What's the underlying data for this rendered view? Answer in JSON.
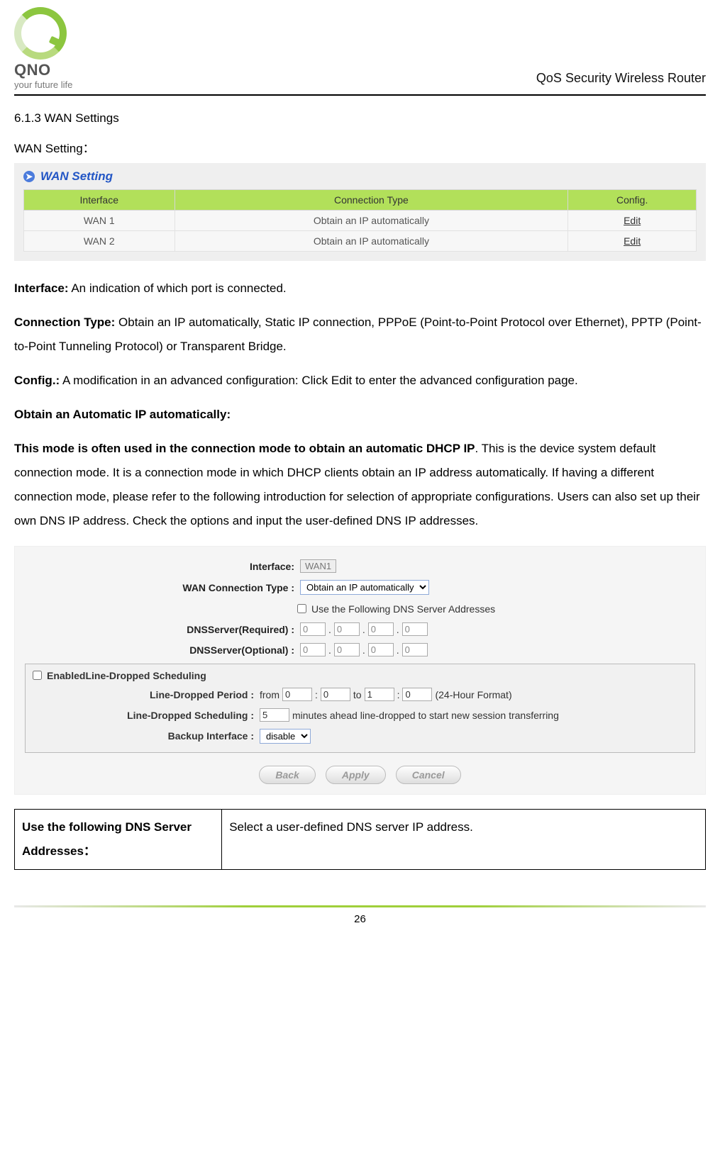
{
  "header": {
    "brand": "QNO",
    "tagline": "your future life",
    "doc_title": "QoS Security Wireless Router"
  },
  "section": {
    "number": "6.1.3 WAN Settings",
    "subtitle": "WAN Setting："
  },
  "wan_panel": {
    "title": "WAN Setting",
    "columns": {
      "c1": "Interface",
      "c2": "Connection Type",
      "c3": "Config."
    },
    "rows": [
      {
        "iface": "WAN 1",
        "type": "Obtain an IP automatically",
        "cfg": "Edit"
      },
      {
        "iface": "WAN 2",
        "type": "Obtain an IP automatically",
        "cfg": "Edit"
      }
    ]
  },
  "body": {
    "interface_label": "Interface:",
    "interface_text": " An indication of which port is connected.",
    "conntype_label": "Connection Type:",
    "conntype_text": " Obtain an IP automatically, Static IP connection, PPPoE (Point-to-Point Protocol over Ethernet), PPTP (Point-to-Point Tunneling Protocol) or Transparent Bridge.",
    "config_label": "Config.:",
    "config_text": " A modification in an advanced configuration: Click Edit to enter the advanced configuration page.",
    "auto_heading": "Obtain an Automatic IP automatically:",
    "auto_bold": "This mode is often used in the connection mode to obtain an automatic DHCP IP",
    "auto_rest": ". This is the device system default connection mode. It is a connection mode in which DHCP clients obtain an IP address automatically. If having a different connection mode, please refer to the following introduction for selection of appropriate configurations. Users can also set up their own DNS IP address. Check the options and input the user-defined DNS IP addresses."
  },
  "form": {
    "interface_label": "Interface:",
    "interface_value": "WAN1",
    "conntype_label": "WAN  Connection Type :",
    "conntype_value": "Obtain an IP automatically",
    "use_dns_label": "Use the Following DNS Server Addresses",
    "dns_req_label": "DNSServer(Required) :",
    "dns_opt_label": "DNSServer(Optional) :",
    "dns_req": [
      "0",
      "0",
      "0",
      "0"
    ],
    "dns_opt": [
      "0",
      "0",
      "0",
      "0"
    ],
    "sched_enable_label": "EnabledLine-Dropped Scheduling",
    "period_label": "Line-Dropped Period :",
    "period_from": "from",
    "period_to": "to",
    "period_vals": {
      "fh": "0",
      "fm": "0",
      "th": "1",
      "tm": "0"
    },
    "period_suffix": "(24-Hour Format)",
    "sched_label": "Line-Dropped Scheduling :",
    "sched_minutes": "5",
    "sched_text": "minutes ahead line-dropped to start new session transferring",
    "backup_label": "Backup Interface :",
    "backup_value": "disable",
    "btn_back": "Back",
    "btn_apply": "Apply",
    "btn_cancel": "Cancel"
  },
  "desc_table": {
    "k": "Use the following DNS Server Addresses：",
    "v": "Select a user-defined DNS server IP address."
  },
  "page_number": "26"
}
